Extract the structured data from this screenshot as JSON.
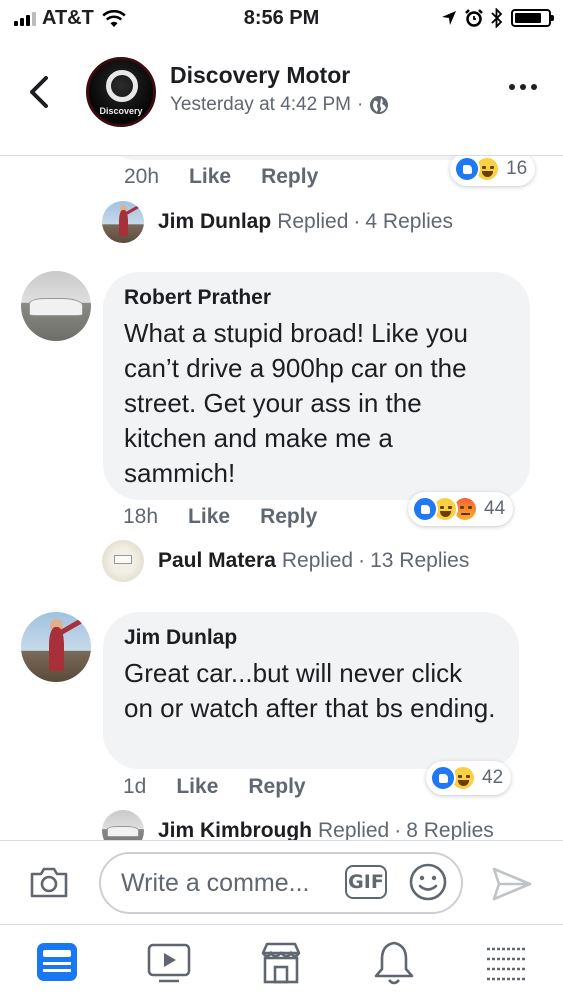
{
  "status_bar": {
    "carrier": "AT&T",
    "time": "8:56 PM"
  },
  "header": {
    "page_name": "Discovery Motor",
    "post_time": "Yesterday at 4:42 PM",
    "separator": "·",
    "avatar_text": "Discovery"
  },
  "top_comment": {
    "age": "20h",
    "like": "Like",
    "reply": "Reply",
    "reaction_count": "16",
    "replies": {
      "name": "Jim Dunlap",
      "action": "Replied",
      "separator": "·",
      "count": "4 Replies"
    }
  },
  "comments": [
    {
      "author": "Robert Prather",
      "text": "What a stupid broad! Like you can’t drive a 900hp car on the street. Get your ass in the kitchen and make me a sammich!",
      "age": "18h",
      "like": "Like",
      "reply": "Reply",
      "reaction_count": "44",
      "replies": {
        "name": "Paul Matera",
        "action": "Replied",
        "separator": "·",
        "count": "13 Replies"
      }
    },
    {
      "author": "Jim Dunlap",
      "text": "Great car...but will never click on or watch after that  bs ending.",
      "age": "1d",
      "like": "Like",
      "reply": "Reply",
      "reaction_count": "42",
      "replies": {
        "name": "Jim Kimbrough",
        "action": "Replied",
        "separator": "·",
        "count": "8 Replies"
      }
    }
  ],
  "composer": {
    "placeholder": "Write a comme...",
    "gif_label": "GIF"
  },
  "tabs": [
    {
      "name": "News Feed",
      "icon": "news-feed-icon",
      "active": true
    },
    {
      "name": "Watch",
      "icon": "video-icon"
    },
    {
      "name": "Marketplace",
      "icon": "marketplace-icon"
    },
    {
      "name": "Notifications",
      "icon": "bell-icon"
    },
    {
      "name": "Menu",
      "icon": "menu-icon"
    }
  ],
  "colors": {
    "accent": "#1877f2",
    "secondary_text": "#606770",
    "bubble": "#f2f3f5"
  }
}
